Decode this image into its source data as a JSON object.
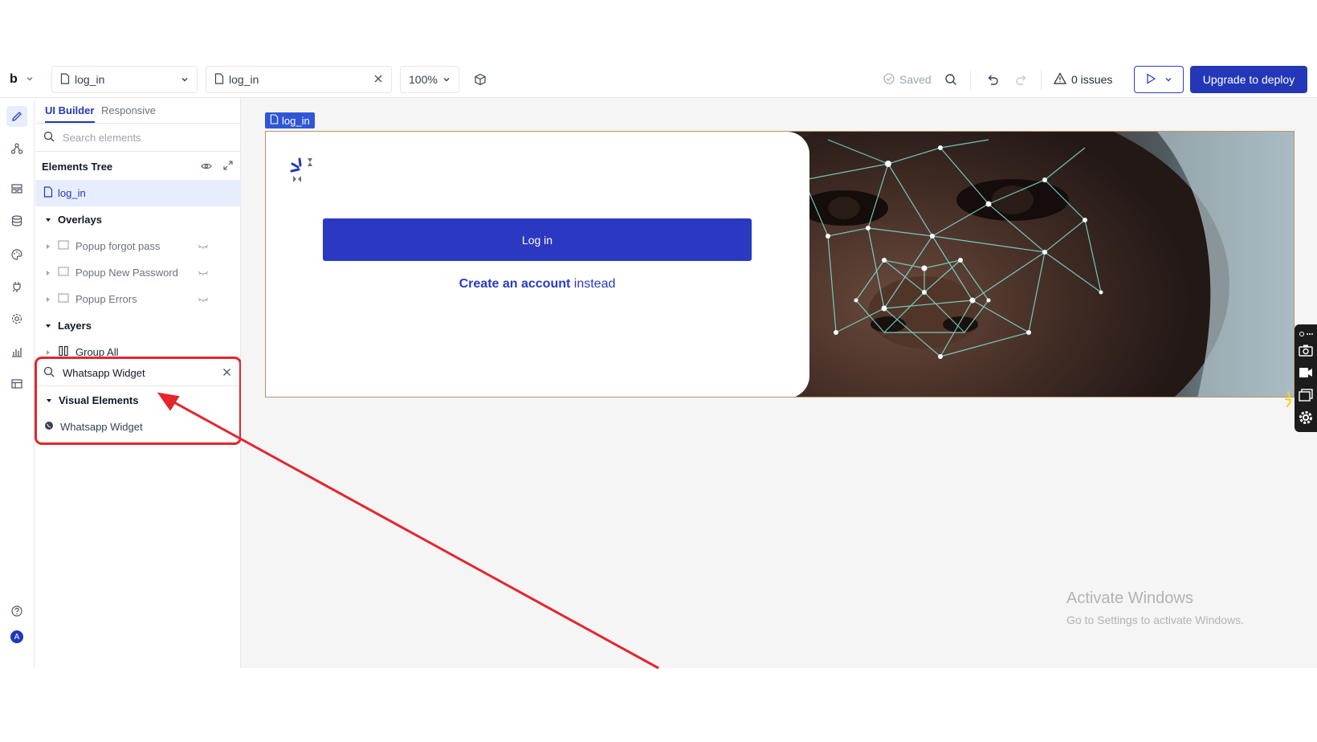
{
  "topbar": {
    "brand": "b",
    "page_select": "log_in",
    "open_page": "log_in",
    "zoom": "100%",
    "saved": "Saved",
    "issues": "0 issues",
    "upgrade": "Upgrade to deploy"
  },
  "panel": {
    "tab_builder": "UI Builder",
    "tab_responsive": "Responsive",
    "search_placeholder": "Search elements",
    "tree_title": "Elements Tree",
    "page_item": "log_in",
    "overlays": "Overlays",
    "popup_forgot": "Popup forgot pass",
    "popup_new_password": "Popup New Password",
    "popup_errors": "Popup Errors",
    "layers": "Layers",
    "group_all": "Group All",
    "search_value": "Whatsapp Widget",
    "visual_elements": "Visual Elements",
    "widget_item": "Whatsapp Widget"
  },
  "sidebar": {
    "avatar": "A"
  },
  "canvas": {
    "page_label": "log_in",
    "login_button": "Log in",
    "create_bold": "Create an account",
    "create_rest": " instead",
    "watermark_title": "Activate Windows",
    "watermark_sub": "Go to Settings to activate Windows."
  },
  "colors": {
    "accent": "#2337b8",
    "highlight": "#e4262c"
  }
}
